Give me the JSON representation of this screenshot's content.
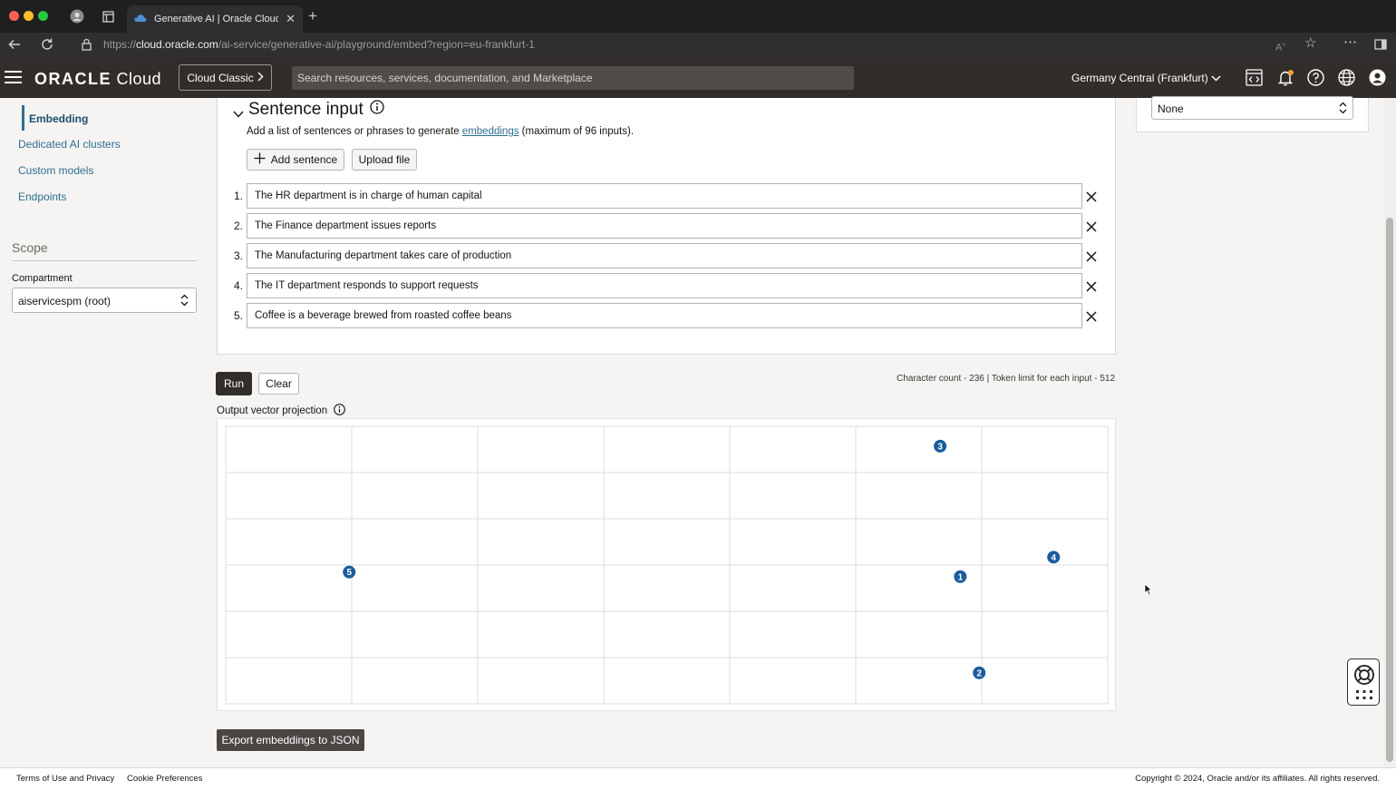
{
  "browser": {
    "tab_title": "Generative AI | Oracle Cloud In",
    "url_prefix": "https://",
    "url_host": "cloud.oracle.com",
    "url_path": "/ai-service/generative-ai/playground/embed?region=eu-frankfurt-1"
  },
  "header": {
    "logo_bold": "ORACLE",
    "logo_light": " Cloud",
    "classic_button": "Cloud Classic",
    "search_placeholder": "Search resources, services, documentation, and Marketplace",
    "region": "Germany Central (Frankfurt)"
  },
  "leftnav": {
    "items": [
      "Embedding",
      "Dedicated AI clusters",
      "Custom models",
      "Endpoints"
    ],
    "active_index": 0,
    "scope_heading": "Scope",
    "compartment_label": "Compartment",
    "compartment_value": "aiservicespm (root)"
  },
  "main": {
    "section_title": "Sentence input",
    "desc_before": "Add a list of sentences or phrases to generate ",
    "desc_link": "embeddings",
    "desc_after": " (maximum of 96 inputs).",
    "add_sentence_button": "Add sentence",
    "upload_button": "Upload file",
    "sentences": [
      {
        "num": "1.",
        "text": "The HR department is in charge of human capital"
      },
      {
        "num": "2.",
        "text": "The Finance department issues reports"
      },
      {
        "num": "3.",
        "text": "The Manufacturing department takes care of production"
      },
      {
        "num": "4.",
        "text": "The IT department responds to support requests"
      },
      {
        "num": "5.",
        "text": "Coffee is a beverage brewed from roasted coffee beans"
      }
    ],
    "run_button": "Run",
    "clear_button": "Clear",
    "char_count": "Character count - 236 | Token limit for each input - 512",
    "projection_label": "Output vector projection",
    "export_button": "Export embeddings to JSON"
  },
  "right": {
    "select_value": "None"
  },
  "chart_data": {
    "type": "scatter",
    "xlim": [
      0,
      7
    ],
    "ylim": [
      0,
      6
    ],
    "grid": true,
    "points": [
      {
        "label": "1",
        "x": 5.83,
        "y": 2.75
      },
      {
        "label": "2",
        "x": 5.98,
        "y": 0.67
      },
      {
        "label": "3",
        "x": 5.67,
        "y": 5.57
      },
      {
        "label": "4",
        "x": 6.57,
        "y": 3.17
      },
      {
        "label": "5",
        "x": 0.98,
        "y": 2.85
      }
    ],
    "point_color": "#1a5c9e"
  },
  "footer": {
    "terms": "Terms of Use and Privacy",
    "cookies": "Cookie Preferences",
    "copyright": "Copyright © 2024, Oracle and/or its affiliates. All rights reserved."
  }
}
